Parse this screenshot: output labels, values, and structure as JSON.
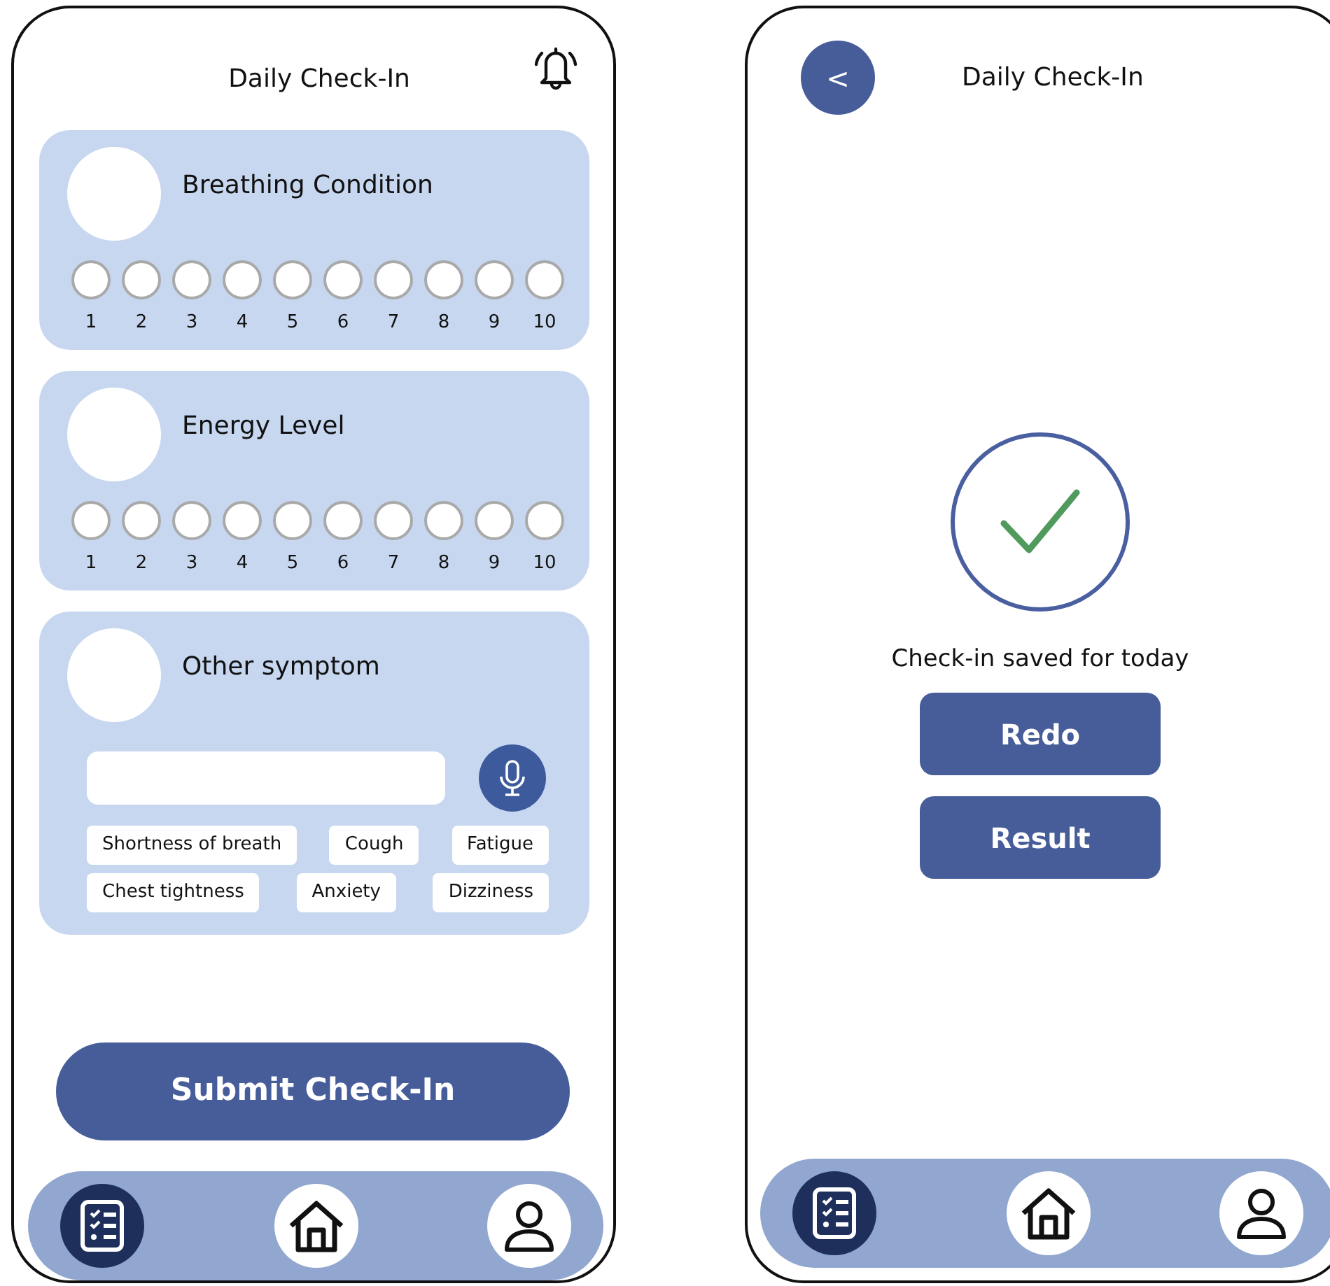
{
  "form_screen": {
    "title": "Daily Check-In",
    "questions": [
      {
        "title": "Breathing Condition",
        "options": [
          {
            "label": "1",
            "selected": false
          },
          {
            "label": "2",
            "selected": false
          },
          {
            "label": "3",
            "selected": false
          },
          {
            "label": "4",
            "selected": false
          },
          {
            "label": "5",
            "selected": false
          },
          {
            "label": "6",
            "selected": false
          },
          {
            "label": "7",
            "selected": false
          },
          {
            "label": "8",
            "selected": false
          },
          {
            "label": "9",
            "selected": false
          },
          {
            "label": "10",
            "selected": false
          }
        ]
      },
      {
        "title": "Energy Level",
        "options": [
          {
            "label": "1",
            "selected": false
          },
          {
            "label": "2",
            "selected": false
          },
          {
            "label": "3",
            "selected": false
          },
          {
            "label": "4",
            "selected": false
          },
          {
            "label": "5",
            "selected": false
          },
          {
            "label": "6",
            "selected": false
          },
          {
            "label": "7",
            "selected": false
          },
          {
            "label": "8",
            "selected": false
          },
          {
            "label": "9",
            "selected": false
          },
          {
            "label": "10",
            "selected": false
          }
        ]
      }
    ],
    "other_symptom": {
      "title": "Other symptom",
      "chips": [
        "Shortness of breath",
        "Cough",
        "Fatigue",
        "Chest tightness",
        "Anxiety",
        "Dizziness"
      ]
    },
    "submit_button": "Submit Check-In",
    "nav": [
      {
        "kind": "checklist",
        "selected": true
      },
      {
        "kind": "home",
        "selected": false
      },
      {
        "kind": "profile",
        "selected": false
      }
    ]
  },
  "confirmation_screen": {
    "back_button": "<",
    "title": "Daily Check-In",
    "message": "Check-in saved for today",
    "buttons": [
      "Redo",
      "Result"
    ],
    "nav": [
      {
        "kind": "checklist",
        "selected": true
      },
      {
        "kind": "home",
        "selected": false
      },
      {
        "kind": "profile",
        "selected": false
      }
    ]
  }
}
